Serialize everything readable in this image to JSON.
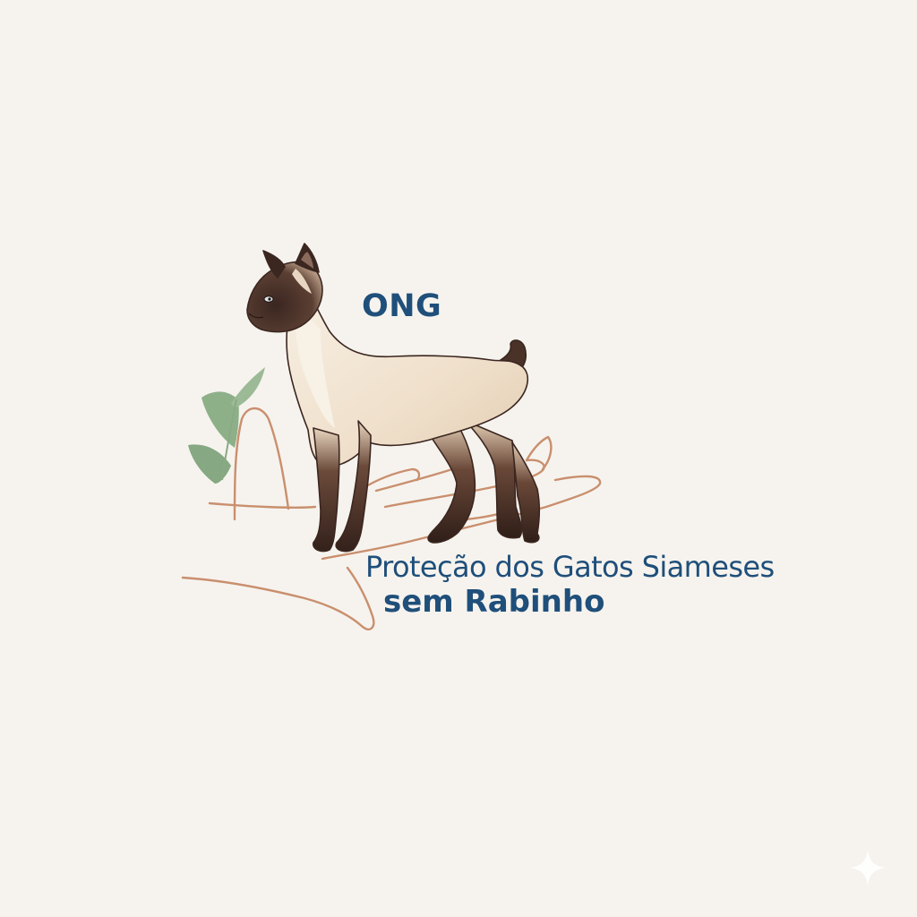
{
  "logo": {
    "org_type": "ONG",
    "name_line1": "Proteção dos Gatos Siameses",
    "name_line2": "sem Rabinho",
    "icons": {
      "cat": "siamese-cat-icon",
      "hand": "open-hand-icon",
      "leaves": "leaf-sprig-icon",
      "corner": "sparkle-icon"
    }
  },
  "colors": {
    "background": "#f6f3ee",
    "text": "#1f4f7a",
    "hand_line": "#c98f6e",
    "leaf": "#8aaf84",
    "cat_body": "#f1e3d0",
    "cat_points": "#3b2620"
  }
}
